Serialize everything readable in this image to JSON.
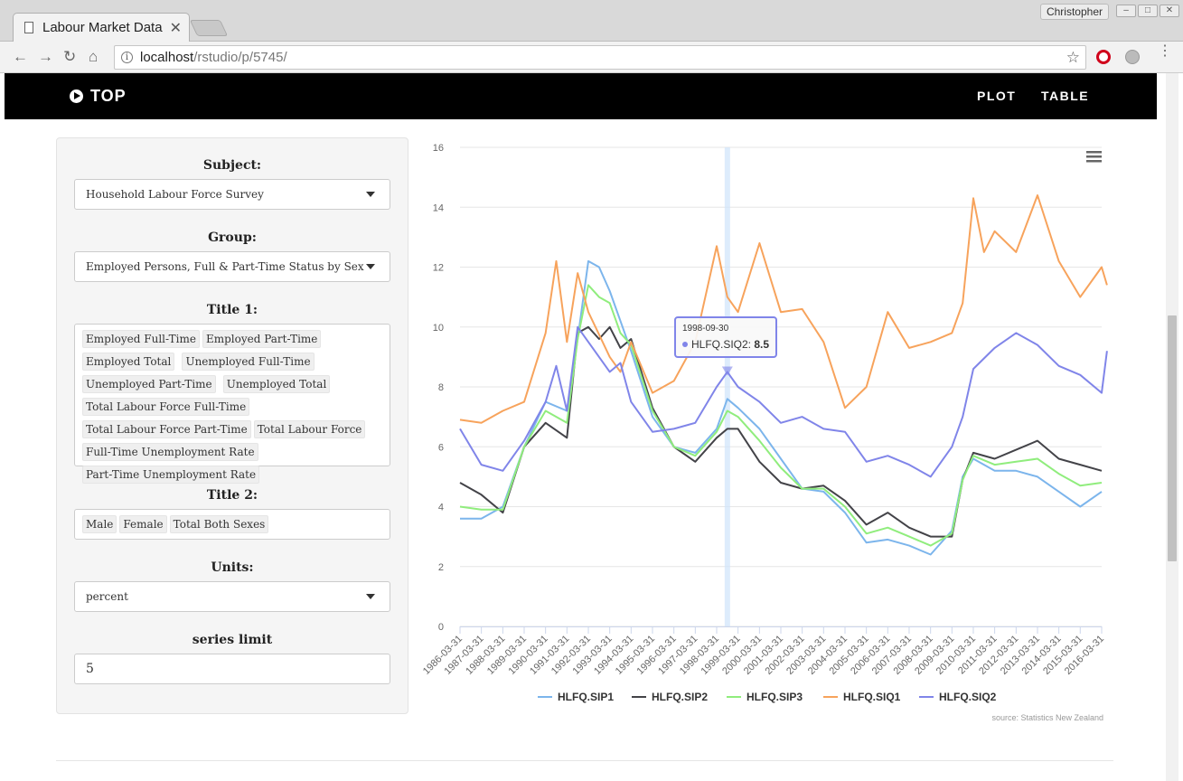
{
  "browser": {
    "tab_title": "Labour Market Data",
    "user_name": "Christopher",
    "url_host": "localhost",
    "url_path": "/rstudio/p/5745/"
  },
  "navbar": {
    "brand": "TOP",
    "links": [
      "PLOT",
      "TABLE"
    ]
  },
  "sidebar": {
    "subject_label": "Subject:",
    "subject_value": "Household Labour Force Survey",
    "group_label": "Group:",
    "group_value": "Employed Persons, Full & Part-Time Status by Sex",
    "title1_label": "Title 1:",
    "title1_tags": [
      "Employed Full-Time",
      "Employed Part-Time",
      "Employed Total",
      "Unemployed Full-Time",
      "Unemployed Part-Time",
      "Unemployed Total",
      "Total Labour Force Full-Time",
      "Total Labour Force Part-Time",
      "Total Labour Force",
      "Full-Time Unemployment Rate",
      "Part-Time Unemployment Rate"
    ],
    "title2_label": "Title 2:",
    "title2_tags": [
      "Male",
      "Female",
      "Total Both Sexes"
    ],
    "units_label": "Units:",
    "units_value": "percent",
    "limit_label": "series limit",
    "limit_value": "5"
  },
  "chart_data": {
    "type": "line",
    "ylim": [
      0,
      16
    ],
    "yticks": [
      0,
      2,
      4,
      6,
      8,
      10,
      12,
      14,
      16
    ],
    "x_start": "1986-03-31",
    "x_end": "2016-03-31",
    "x_labels": [
      "1986-03-31",
      "1987-03-31",
      "1988-03-31",
      "1989-03-31",
      "1990-03-31",
      "1991-03-31",
      "1992-03-31",
      "1993-03-31",
      "1994-03-31",
      "1995-03-31",
      "1996-03-31",
      "1997-03-31",
      "1998-03-31",
      "1999-03-31",
      "2000-03-31",
      "2001-03-31",
      "2002-03-31",
      "2003-03-31",
      "2004-03-31",
      "2005-03-31",
      "2006-03-31",
      "2007-03-31",
      "2008-03-31",
      "2009-03-31",
      "2010-03-31",
      "2011-03-31",
      "2012-03-31",
      "2013-03-31",
      "2014-03-31",
      "2015-03-31",
      "2016-03-31"
    ],
    "grid": true,
    "legend_position": "bottom",
    "series_colors": [
      "#7cb5ec",
      "#434348",
      "#90ed7d",
      "#f7a35c",
      "#8085e9"
    ],
    "series": [
      {
        "name": "HLFQ.SIP1",
        "points": [
          [
            "1986-03-31",
            3.6
          ],
          [
            "1987-03-31",
            3.6
          ],
          [
            "1988-03-31",
            4.0
          ],
          [
            "1989-03-31",
            6.0
          ],
          [
            "1990-03-31",
            7.5
          ],
          [
            "1991-03-31",
            7.2
          ],
          [
            "1991-09-30",
            9.6
          ],
          [
            "1992-03-31",
            12.2
          ],
          [
            "1992-09-30",
            12.0
          ],
          [
            "1993-03-31",
            11.2
          ],
          [
            "1993-09-30",
            10.2
          ],
          [
            "1994-03-31",
            9.2
          ],
          [
            "1995-03-31",
            7.0
          ],
          [
            "1996-03-31",
            6.0
          ],
          [
            "1997-03-31",
            5.8
          ],
          [
            "1998-03-31",
            6.6
          ],
          [
            "1998-09-30",
            7.6
          ],
          [
            "1999-03-31",
            7.3
          ],
          [
            "2000-03-31",
            6.6
          ],
          [
            "2001-03-31",
            5.6
          ],
          [
            "2002-03-31",
            4.6
          ],
          [
            "2003-03-31",
            4.5
          ],
          [
            "2004-03-31",
            3.8
          ],
          [
            "2005-03-31",
            2.8
          ],
          [
            "2006-03-31",
            2.9
          ],
          [
            "2007-03-31",
            2.7
          ],
          [
            "2008-03-31",
            2.4
          ],
          [
            "2009-03-31",
            3.2
          ],
          [
            "2009-09-30",
            5.0
          ],
          [
            "2010-03-31",
            5.6
          ],
          [
            "2011-03-31",
            5.2
          ],
          [
            "2012-03-31",
            5.2
          ],
          [
            "2013-03-31",
            5.0
          ],
          [
            "2014-03-31",
            4.5
          ],
          [
            "2015-03-31",
            4.0
          ],
          [
            "2016-03-31",
            4.5
          ]
        ]
      },
      {
        "name": "HLFQ.SIP2",
        "points": [
          [
            "1986-03-31",
            4.8
          ],
          [
            "1987-03-31",
            4.4
          ],
          [
            "1988-03-31",
            3.8
          ],
          [
            "1989-03-31",
            6.0
          ],
          [
            "1990-03-31",
            6.8
          ],
          [
            "1991-03-31",
            6.3
          ],
          [
            "1991-09-30",
            9.8
          ],
          [
            "1992-03-31",
            10.0
          ],
          [
            "1992-09-30",
            9.6
          ],
          [
            "1993-03-31",
            10.0
          ],
          [
            "1993-09-30",
            9.3
          ],
          [
            "1994-03-31",
            9.6
          ],
          [
            "1995-03-31",
            7.3
          ],
          [
            "1996-03-31",
            6.0
          ],
          [
            "1997-03-31",
            5.5
          ],
          [
            "1998-03-31",
            6.3
          ],
          [
            "1998-09-30",
            6.6
          ],
          [
            "1999-03-31",
            6.6
          ],
          [
            "2000-03-31",
            5.5
          ],
          [
            "2001-03-31",
            4.8
          ],
          [
            "2002-03-31",
            4.6
          ],
          [
            "2003-03-31",
            4.7
          ],
          [
            "2004-03-31",
            4.2
          ],
          [
            "2005-03-31",
            3.4
          ],
          [
            "2006-03-31",
            3.8
          ],
          [
            "2007-03-31",
            3.3
          ],
          [
            "2008-03-31",
            3.0
          ],
          [
            "2009-03-31",
            3.0
          ],
          [
            "2009-09-30",
            4.9
          ],
          [
            "2010-03-31",
            5.8
          ],
          [
            "2011-03-31",
            5.6
          ],
          [
            "2012-03-31",
            5.9
          ],
          [
            "2013-03-31",
            6.2
          ],
          [
            "2014-03-31",
            5.6
          ],
          [
            "2015-03-31",
            5.4
          ],
          [
            "2016-03-31",
            5.2
          ]
        ]
      },
      {
        "name": "HLFQ.SIP3",
        "points": [
          [
            "1986-03-31",
            4.0
          ],
          [
            "1987-03-31",
            3.9
          ],
          [
            "1988-03-31",
            3.9
          ],
          [
            "1989-03-31",
            6.0
          ],
          [
            "1990-03-31",
            7.2
          ],
          [
            "1991-03-31",
            6.8
          ],
          [
            "1991-09-30",
            9.6
          ],
          [
            "1992-03-31",
            11.4
          ],
          [
            "1992-09-30",
            11.0
          ],
          [
            "1993-03-31",
            10.8
          ],
          [
            "1993-09-30",
            9.8
          ],
          [
            "1994-03-31",
            9.4
          ],
          [
            "1995-03-31",
            7.2
          ],
          [
            "1996-03-31",
            6.0
          ],
          [
            "1997-03-31",
            5.7
          ],
          [
            "1998-03-31",
            6.5
          ],
          [
            "1998-09-30",
            7.2
          ],
          [
            "1999-03-31",
            7.0
          ],
          [
            "2000-03-31",
            6.2
          ],
          [
            "2001-03-31",
            5.3
          ],
          [
            "2002-03-31",
            4.6
          ],
          [
            "2003-03-31",
            4.6
          ],
          [
            "2004-03-31",
            4.0
          ],
          [
            "2005-03-31",
            3.1
          ],
          [
            "2006-03-31",
            3.3
          ],
          [
            "2007-03-31",
            3.0
          ],
          [
            "2008-03-31",
            2.7
          ],
          [
            "2009-03-31",
            3.1
          ],
          [
            "2009-09-30",
            4.9
          ],
          [
            "2010-03-31",
            5.7
          ],
          [
            "2011-03-31",
            5.4
          ],
          [
            "2012-03-31",
            5.5
          ],
          [
            "2013-03-31",
            5.6
          ],
          [
            "2014-03-31",
            5.1
          ],
          [
            "2015-03-31",
            4.7
          ],
          [
            "2016-03-31",
            4.8
          ]
        ]
      },
      {
        "name": "HLFQ.SIQ1",
        "points": [
          [
            "1986-03-31",
            6.9
          ],
          [
            "1987-03-31",
            6.8
          ],
          [
            "1988-03-31",
            7.2
          ],
          [
            "1989-03-31",
            7.5
          ],
          [
            "1990-03-31",
            9.8
          ],
          [
            "1990-09-30",
            12.2
          ],
          [
            "1991-03-31",
            9.5
          ],
          [
            "1991-09-30",
            11.8
          ],
          [
            "1992-03-31",
            10.5
          ],
          [
            "1993-03-31",
            9.0
          ],
          [
            "1993-09-30",
            8.5
          ],
          [
            "1994-03-31",
            9.5
          ],
          [
            "1995-03-31",
            7.8
          ],
          [
            "1996-03-31",
            8.2
          ],
          [
            "1997-03-31",
            9.5
          ],
          [
            "1998-03-31",
            12.7
          ],
          [
            "1998-09-30",
            11.0
          ],
          [
            "1999-03-31",
            10.5
          ],
          [
            "2000-03-31",
            12.8
          ],
          [
            "2001-03-31",
            10.5
          ],
          [
            "2002-03-31",
            10.6
          ],
          [
            "2003-03-31",
            9.5
          ],
          [
            "2004-03-31",
            7.3
          ],
          [
            "2005-03-31",
            8.0
          ],
          [
            "2006-03-31",
            10.5
          ],
          [
            "2007-03-31",
            9.3
          ],
          [
            "2008-03-31",
            9.5
          ],
          [
            "2009-03-31",
            9.8
          ],
          [
            "2009-09-30",
            10.8
          ],
          [
            "2010-03-31",
            14.3
          ],
          [
            "2010-09-30",
            12.5
          ],
          [
            "2011-03-31",
            13.2
          ],
          [
            "2012-03-31",
            12.5
          ],
          [
            "2013-03-31",
            14.4
          ],
          [
            "2014-03-31",
            12.2
          ],
          [
            "2015-03-31",
            11.0
          ],
          [
            "2016-03-31",
            12.0
          ],
          [
            "2016-06-30",
            11.4
          ]
        ]
      },
      {
        "name": "HLFQ.SIQ2",
        "points": [
          [
            "1986-03-31",
            6.6
          ],
          [
            "1987-03-31",
            5.4
          ],
          [
            "1988-03-31",
            5.2
          ],
          [
            "1989-03-31",
            6.2
          ],
          [
            "1990-03-31",
            7.5
          ],
          [
            "1990-09-30",
            8.7
          ],
          [
            "1991-03-31",
            7.2
          ],
          [
            "1991-09-30",
            10.0
          ],
          [
            "1992-03-31",
            9.5
          ],
          [
            "1993-03-31",
            8.5
          ],
          [
            "1993-09-30",
            8.8
          ],
          [
            "1994-03-31",
            7.5
          ],
          [
            "1995-03-31",
            6.5
          ],
          [
            "1996-03-31",
            6.6
          ],
          [
            "1997-03-31",
            6.8
          ],
          [
            "1998-03-31",
            8.0
          ],
          [
            "1998-09-30",
            8.5
          ],
          [
            "1999-03-31",
            8.0
          ],
          [
            "2000-03-31",
            7.5
          ],
          [
            "2001-03-31",
            6.8
          ],
          [
            "2002-03-31",
            7.0
          ],
          [
            "2003-03-31",
            6.6
          ],
          [
            "2004-03-31",
            6.5
          ],
          [
            "2005-03-31",
            5.5
          ],
          [
            "2006-03-31",
            5.7
          ],
          [
            "2007-03-31",
            5.4
          ],
          [
            "2008-03-31",
            5.0
          ],
          [
            "2009-03-31",
            6.0
          ],
          [
            "2009-09-30",
            7.0
          ],
          [
            "2010-03-31",
            8.6
          ],
          [
            "2011-03-31",
            9.3
          ],
          [
            "2012-03-31",
            9.8
          ],
          [
            "2013-03-31",
            9.4
          ],
          [
            "2014-03-31",
            8.7
          ],
          [
            "2015-03-31",
            8.4
          ],
          [
            "2016-03-31",
            7.8
          ],
          [
            "2016-06-30",
            9.2
          ]
        ]
      }
    ],
    "tooltip": {
      "date": "1998-09-30",
      "series": "HLFQ.SIQ2",
      "value": "8.5"
    },
    "highlight_x": "1998-09-30",
    "credit": "source: Statistics New Zealand"
  }
}
